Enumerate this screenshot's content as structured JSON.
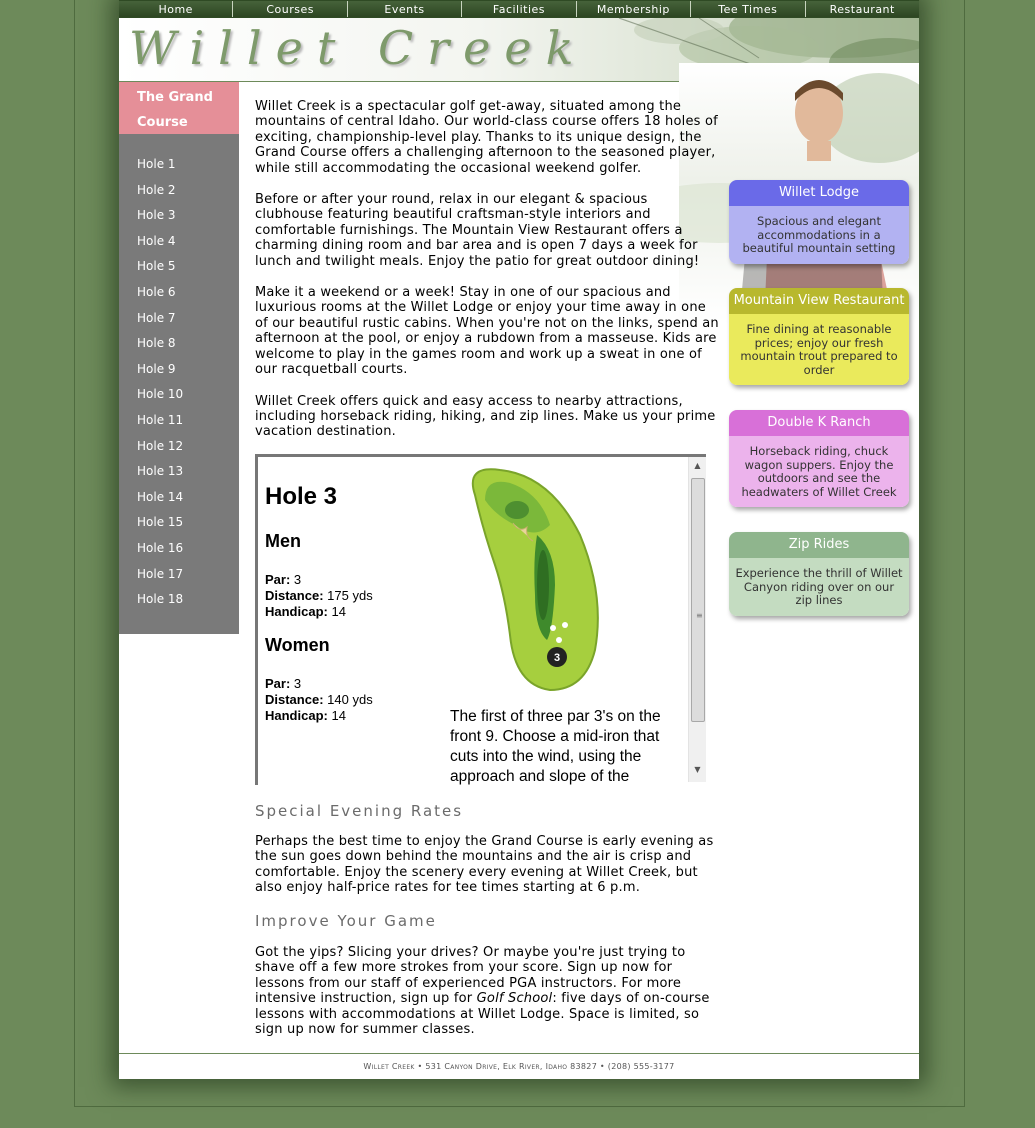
{
  "nav": [
    "Home",
    "Courses",
    "Events",
    "Facilities",
    "Membership",
    "Tee Times",
    "Restaurant"
  ],
  "banner": {
    "logo": "Willet Creek"
  },
  "sidebar": {
    "heading": "The Grand Course",
    "holes": [
      "Hole 1",
      "Hole 2",
      "Hole 3",
      "Hole 4",
      "Hole 5",
      "Hole 6",
      "Hole 7",
      "Hole 8",
      "Hole 9",
      "Hole 10",
      "Hole 11",
      "Hole 12",
      "Hole 13",
      "Hole 14",
      "Hole 15",
      "Hole 16",
      "Hole 17",
      "Hole 18"
    ]
  },
  "content": {
    "paragraphs": [
      "Willet Creek is a spectacular golf get-away, situated among the mountains of central Idaho. Our world-class course offers 18 holes of exciting, championship-level play. Thanks to its unique design, the Grand Course offers a challenging afternoon to the seasoned player, while still accommodating the occasional weekend golfer.",
      "Before or after your round, relax in our elegant & spacious clubhouse featuring beautiful craftsman-style interiors and comfortable furnishings. The Mountain View Restaurant offers a charming dining room and bar area and is open 7 days a week for lunch and twilight meals. Enjoy the patio for great outdoor dining!",
      "Make it a weekend or a week! Stay in one of our spacious and luxurious rooms at the Willet Lodge or enjoy your time away in one of our beautiful rustic cabins. When you're not on the links, spend an afternoon at the pool, or enjoy a rubdown from a masseuse. Kids are welcome to play in the games room and work up a sweat in one of our racquetball courts.",
      "Willet Creek offers quick and easy access to nearby attractions, including horseback riding, hiking, and zip lines. Make us your prime vacation destination."
    ]
  },
  "hole": {
    "title": "Hole 3",
    "men_heading": "Men",
    "women_heading": "Women",
    "par_label": "Par:",
    "distance_label": "Distance:",
    "handicap_label": "Handicap:",
    "men": {
      "par": "3",
      "distance": "175 yds",
      "handicap": "14"
    },
    "women": {
      "par": "3",
      "distance": "140 yds",
      "handicap": "14"
    },
    "marker": "3",
    "description": "The first of three par 3's on the front 9. Choose a mid-iron that cuts into the wind, using the approach and slope of the"
  },
  "sections": {
    "evening_heading": "Special Evening Rates",
    "evening_text": "Perhaps the best time to enjoy the Grand Course is early evening as the sun goes down behind the mountains and the air is crisp and comfortable. Enjoy the scenery every evening at Willet Creek, but also enjoy half-price rates for tee times starting at 6 p.m.",
    "improve_heading": "Improve Your Game",
    "improve_text_before": "Got the yips? Slicing your drives? Or maybe you're just trying to shave off a few more strokes from your score. Sign up now for lessons from our staff of experienced PGA instructors. For more intensive instruction, sign up for ",
    "improve_text_em": "Golf School",
    "improve_text_after": ": five days of on-course lessons with accommodations at Willet Lodge. Space is limited, so sign up now for summer classes."
  },
  "cards": [
    {
      "title": "Willet Lodge",
      "body": "Spacious and elegant accommodations in a beautiful mountain setting",
      "title_color": "#6a6ae8",
      "body_color": "#b2b2f2"
    },
    {
      "title": "Mountain View Restaurant",
      "body": "Fine dining at reasonable prices; enjoy our fresh mountain trout prepared to order",
      "title_color": "#b8b82e",
      "body_color": "#eaea5c"
    },
    {
      "title": "Double K Ranch",
      "body": "Horseback riding, chuck wagon suppers. Enjoy the outdoors and see the headwaters of Willet Creek",
      "title_color": "#d870d8",
      "body_color": "#ecb3ec"
    },
    {
      "title": "Zip Rides",
      "body": "Experience the thrill of Willet Canyon riding over on our zip lines",
      "title_color": "#8fb58d",
      "body_color": "#c4dcc1"
    }
  ],
  "footer": {
    "text": "Willet Creek • 531 Canyon Drive, Elk River, Idaho 83827 • (208) 555-3177"
  }
}
